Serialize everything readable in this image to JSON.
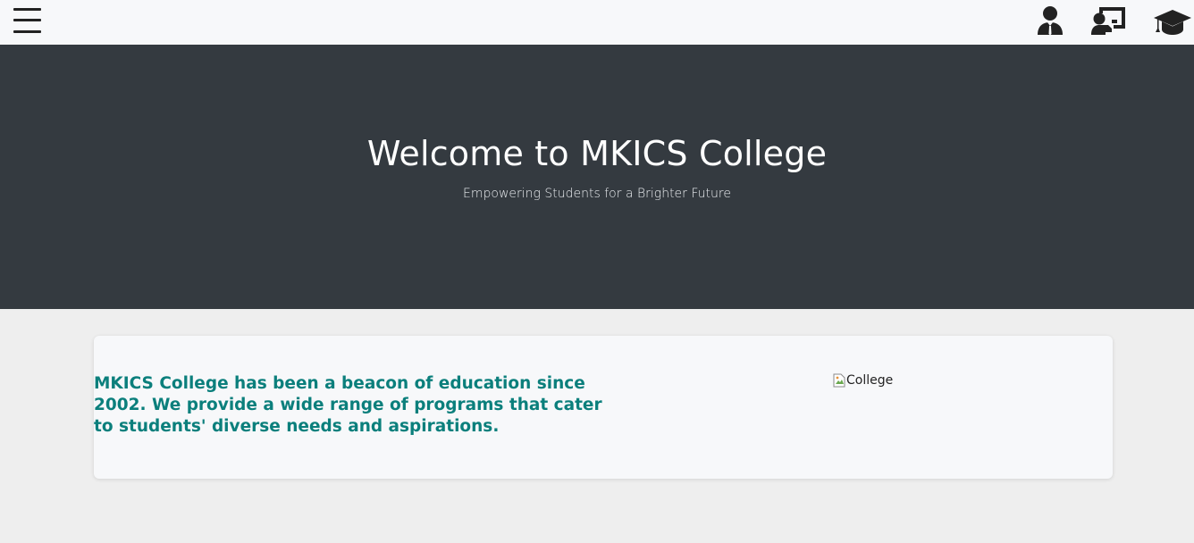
{
  "header": {
    "menu_label": "Menu",
    "icons": [
      {
        "name": "student-icon",
        "label": "Student"
      },
      {
        "name": "teacher-icon",
        "label": "Teacher"
      },
      {
        "name": "graduation-cap-icon",
        "label": "Graduation"
      }
    ]
  },
  "hero": {
    "title": "Welcome to MKICS College",
    "subtitle": "Empowering Students for a Brighter Future"
  },
  "about": {
    "text": "MKICS College has been a beacon of education since 2002. We provide a wide range of programs that cater to students' diverse needs and aspirations.",
    "image_alt": "College"
  },
  "colors": {
    "hero_bg": "#343a40",
    "accent_text": "#0b7f7c",
    "page_bg": "#eeeeee",
    "card_bg": "#f7f8fa"
  }
}
